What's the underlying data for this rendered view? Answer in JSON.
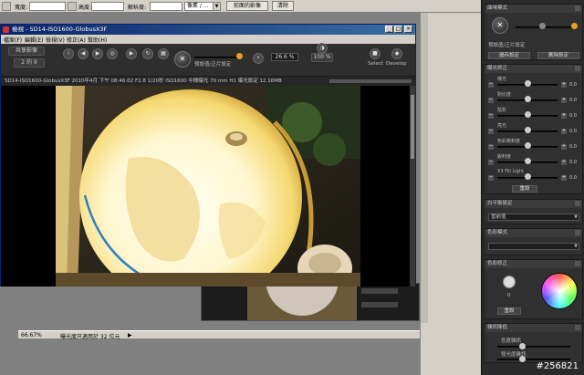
{
  "topbar": {
    "width_label": "寬度:",
    "height_label": "高度:",
    "resolution_label": "解析度:",
    "unit_select": "像素 / ...",
    "front_image_button": "前面的影像",
    "clear_button": "清除"
  },
  "raw_window": {
    "title": "檢視 - SD14-ISO1600-GlobusX3F",
    "minimize": "_",
    "maximize": "□",
    "close": "×",
    "menu": [
      "檔案(F)",
      "編輯(E)",
      "檢視(V)",
      "修正(A)",
      "幫助(H)"
    ],
    "toolbar": {
      "open_button": "共享影像",
      "page_select": "2 的 9",
      "preset_label": "預設值/正片設定",
      "zoom_value": "26.6",
      "zoom_unit": "%",
      "zoom_fit": "100 %",
      "right_label_1": "Select",
      "right_label_2": "Screen",
      "right_label_3": "Develop"
    },
    "info_line": "SD14-ISO1600-GlobusX3F 2010年4月 下午 08:46:02 F2.8 1/20秒 ISO1600 中間曝光 70 mm H1 曝光設定 12.16MB"
  },
  "ps_status": {
    "zoom": "66.67%",
    "message": "曝光度只適用於 32 位元"
  },
  "right_panel": {
    "taste_section": "曲味模式",
    "preset_label": "預設值/正片設定",
    "save_button": "儲存設定",
    "delete_button": "刪除設定",
    "exposure_section": "曝光修正",
    "rows": [
      {
        "label": "曝光",
        "value": "0.0"
      },
      {
        "label": "對比度",
        "value": "0.0"
      },
      {
        "label": "陰影",
        "value": "0.0"
      },
      {
        "label": "亮光",
        "value": "0.0"
      },
      {
        "label": "色彩飽和度",
        "value": "0.0"
      },
      {
        "label": "銳利度",
        "value": "0.0"
      },
      {
        "label": "X3 Fill Light",
        "value": "0.0"
      }
    ],
    "reset_button": "重設",
    "wb_section": "白平衡設定",
    "wb_select": "當前值",
    "color_section": "色彩模式",
    "hue_section": "色彩修正",
    "hue_value": "0",
    "reset_button_2": "重設",
    "noise_section": "雜訊降低",
    "noise_row_1": "色度雜訊",
    "noise_row_2": "發光度雜訊"
  },
  "watermark": "#256821",
  "colors": {
    "ps_chrome": "#d4d0c8",
    "titlebar": "#0a246a",
    "panel_dark": "#2a2a2a",
    "accent_orange": "#e8a020"
  }
}
